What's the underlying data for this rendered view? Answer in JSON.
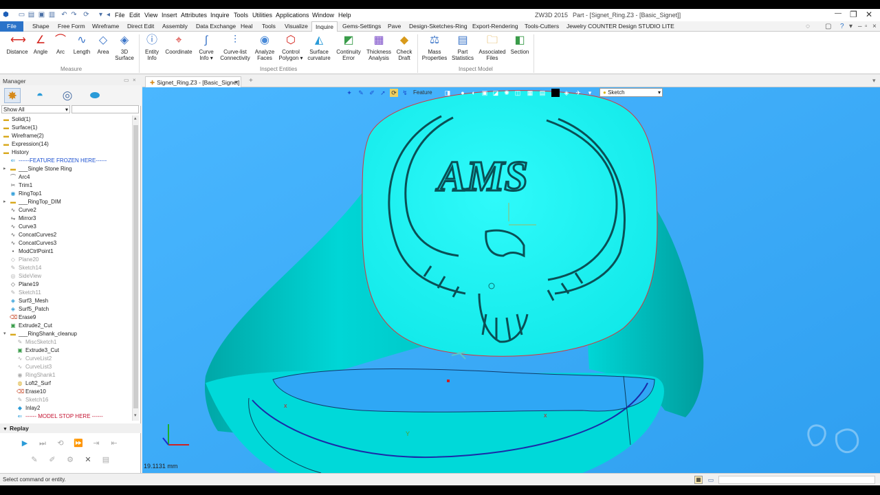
{
  "app": {
    "product": "ZW3D 2015",
    "window_title": "Part - [Signet_Ring.Z3 - [Basic_Signet]]",
    "menu": [
      "File",
      "Edit",
      "View",
      "Insert",
      "Attributes",
      "Inquire",
      "Tools",
      "Utilities",
      "Applications",
      "Window",
      "Help"
    ]
  },
  "ribbon_tabs": [
    "File",
    "Shape",
    "Free Form",
    "Wireframe",
    "Direct Edit",
    "Assembly",
    "Data Exchange",
    "Heal",
    "Tools",
    "Visualize",
    "Inquire",
    "Gems-Settings",
    "Pave",
    "Design-Sketches-Ring",
    "Export-Rendering",
    "Tools-Cutters",
    "Jewelry COUNTER Design STUDIO LITE"
  ],
  "active_tab": "Inquire",
  "ribbon": {
    "measure": {
      "group": "Measure",
      "buttons": [
        {
          "label": "Distance",
          "icon": "distance-icon"
        },
        {
          "label": "Angle",
          "icon": "angle-icon"
        },
        {
          "label": "Arc",
          "icon": "arc-icon"
        },
        {
          "label": "Length",
          "icon": "length-icon"
        },
        {
          "label": "Area",
          "icon": "area-icon"
        },
        {
          "label": "3D\nSurface",
          "icon": "3d-surface-icon"
        }
      ]
    },
    "inspect_entities": {
      "group": "Inspect Entities",
      "buttons": [
        {
          "label": "Entity\nInfo",
          "icon": "entity-info-icon"
        },
        {
          "label": "Coordinate",
          "icon": "coordinate-icon"
        },
        {
          "label": "Curve\nInfo ▾",
          "icon": "curve-info-icon"
        },
        {
          "label": "Curve-list\nConnectivity",
          "icon": "curve-list-icon"
        },
        {
          "label": "Analyze\nFaces",
          "icon": "analyze-faces-icon"
        },
        {
          "label": "Control\nPolygon ▾",
          "icon": "control-polygon-icon"
        },
        {
          "label": "Surface\ncurvature",
          "icon": "surface-curvature-icon"
        },
        {
          "label": "Continuity\nError",
          "icon": "continuity-icon"
        },
        {
          "label": "Thickness\nAnalysis",
          "icon": "thickness-icon"
        },
        {
          "label": "Check\nDraft",
          "icon": "check-draft-icon"
        }
      ]
    },
    "inspect_model": {
      "group": "Inspect Model",
      "buttons": [
        {
          "label": "Mass\nProperties",
          "icon": "mass-properties-icon"
        },
        {
          "label": "Part\nStatistics",
          "icon": "part-statistics-icon"
        },
        {
          "label": "Associated\nFiles",
          "icon": "associated-files-icon"
        },
        {
          "label": "Section",
          "icon": "section-icon"
        }
      ]
    }
  },
  "manager": {
    "title": "Manager",
    "filter": "Show All",
    "tree": [
      {
        "label": "Solid(1)",
        "icon": "folder-icon",
        "state": "normal"
      },
      {
        "label": "Surface(1)",
        "icon": "folder-icon",
        "state": "normal"
      },
      {
        "label": "Wireframe(2)",
        "icon": "folder-icon",
        "state": "normal"
      },
      {
        "label": "Expression(14)",
        "icon": "folder-icon",
        "state": "normal"
      },
      {
        "label": "History",
        "icon": "folder-icon",
        "state": "normal"
      },
      {
        "label": "------FEATURE FROZEN HERE------",
        "icon": "arrow-icon",
        "state": "blue"
      },
      {
        "label": "___Single Stone Ring",
        "icon": "folder-icon",
        "state": "normal"
      },
      {
        "label": "Arc4",
        "icon": "arc-icon",
        "state": "normal"
      },
      {
        "label": "Trim1",
        "icon": "trim-icon",
        "state": "normal"
      },
      {
        "label": "RingTop1",
        "icon": "ring-icon",
        "state": "normal"
      },
      {
        "label": "___RingTop_DIM",
        "icon": "folder-icon",
        "state": "normal"
      },
      {
        "label": "Curve2",
        "icon": "curve-icon",
        "state": "normal"
      },
      {
        "label": "Mirror3",
        "icon": "mirror-icon",
        "state": "normal"
      },
      {
        "label": "Curve3",
        "icon": "curve-icon",
        "state": "normal"
      },
      {
        "label": "ConcatCurves2",
        "icon": "curve-icon",
        "state": "normal"
      },
      {
        "label": "ConcatCurves3",
        "icon": "curve-icon",
        "state": "normal"
      },
      {
        "label": "ModCtrlPoint1",
        "icon": "point-icon",
        "state": "normal"
      },
      {
        "label": "Plane20",
        "icon": "plane-icon",
        "state": "dim"
      },
      {
        "label": "Sketch14",
        "icon": "sketch-icon",
        "state": "dim"
      },
      {
        "label": "SideView",
        "icon": "view-icon",
        "state": "dim"
      },
      {
        "label": "Plane19",
        "icon": "plane-icon",
        "state": "normal"
      },
      {
        "label": "Sketch11",
        "icon": "sketch-icon",
        "state": "dim"
      },
      {
        "label": "Surf3_Mesh",
        "icon": "surface-icon",
        "state": "normal"
      },
      {
        "label": "Surf5_Patch",
        "icon": "surface-icon",
        "state": "normal"
      },
      {
        "label": "Erase9",
        "icon": "erase-icon",
        "state": "normal"
      },
      {
        "label": "Extrude2_Cut",
        "icon": "extrude-icon",
        "state": "normal"
      },
      {
        "label": "___RingShank_cleanup",
        "icon": "folder-open-icon",
        "state": "normal"
      },
      {
        "label": "MiscSketch1",
        "icon": "sketch-icon",
        "state": "dim"
      },
      {
        "label": "Extrude3_Cut",
        "icon": "extrude-icon",
        "state": "normal"
      },
      {
        "label": "CurveList2",
        "icon": "curve-icon",
        "state": "dim"
      },
      {
        "label": "CurveList3",
        "icon": "curve-icon",
        "state": "dim"
      },
      {
        "label": "RingShank1",
        "icon": "ring-icon",
        "state": "dim"
      },
      {
        "label": "Loft2_Surf",
        "icon": "loft-icon",
        "state": "normal"
      },
      {
        "label": "Erase10",
        "icon": "erase-icon",
        "state": "normal"
      },
      {
        "label": "Sketch16",
        "icon": "sketch-icon",
        "state": "dim"
      },
      {
        "label": "Inlay2",
        "icon": "inlay-icon",
        "state": "normal"
      },
      {
        "label": "------ MODEL STOP HERE ------",
        "icon": "arrow-icon",
        "state": "red"
      }
    ]
  },
  "replay": {
    "title": "Replay"
  },
  "document_tab": "Signet_Ring.Z3 - [Basic_Signet]",
  "viewport": {
    "feature_label": "Feature",
    "sketch_select": "Sketch",
    "measure_readout": "19.1131 mm",
    "engraving_text": "AMS",
    "model_color": "#00eaea",
    "background_color": "#3eafff"
  },
  "status": {
    "message": "Select command or entity."
  }
}
